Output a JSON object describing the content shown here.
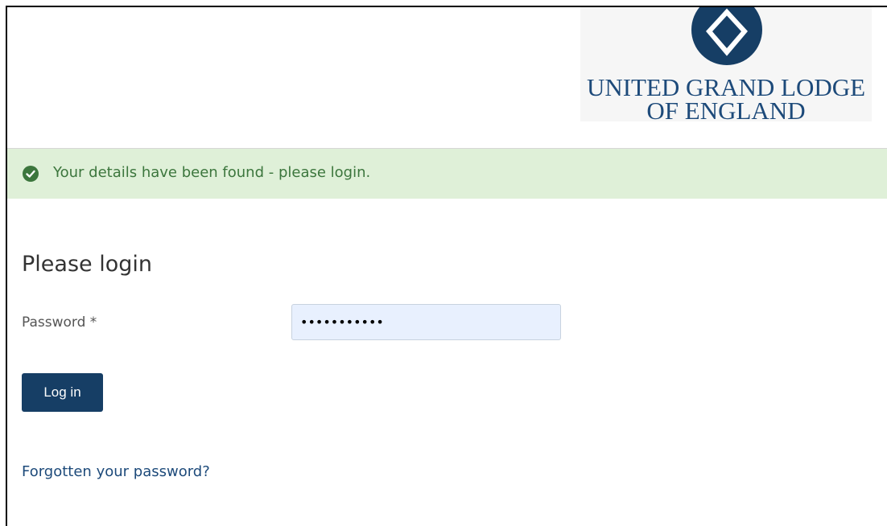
{
  "header": {
    "logo": {
      "line1": "UNITED GRAND LODGE",
      "line2": "OF ENGLAND",
      "emblem_icon": "square-and-compasses-emblem-icon"
    }
  },
  "alert": {
    "icon": "check-circle-icon",
    "message": "Your details have been found - please login."
  },
  "form": {
    "title": "Please login",
    "password_label": "Password *",
    "password_value": "•••••••••••",
    "login_button_label": "Log in",
    "forgot_link": "Forgotten your password?"
  },
  "colors": {
    "brand": "#1d4a7a",
    "button": "#163e65",
    "alert_bg": "#dff0d8",
    "alert_text": "#3c763d",
    "success_icon": "#3c763d"
  }
}
